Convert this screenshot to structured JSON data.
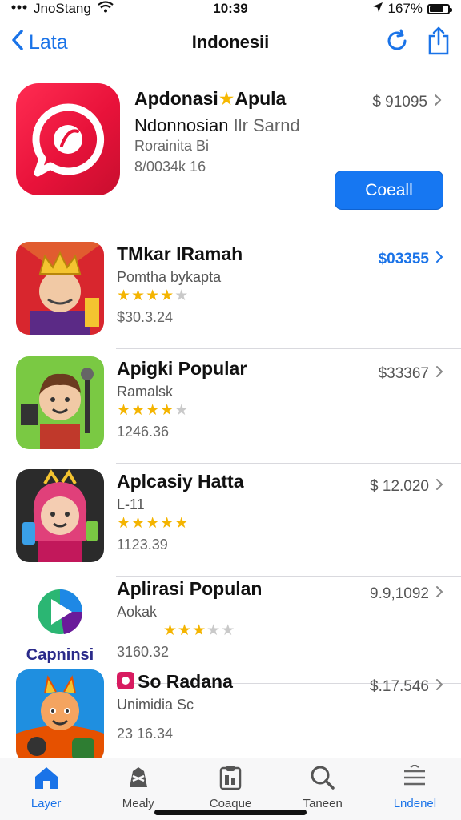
{
  "status_bar": {
    "carrier": "JnoStang",
    "time": "10:39",
    "battery_percent": "167%"
  },
  "nav": {
    "back_label": "Lata",
    "title": "Indonesii"
  },
  "featured": {
    "title": "Apdonasi",
    "title_star": "★",
    "title_suffix": "Apula",
    "subtitle": "Ndonnosian",
    "subtitle_muted": "Ilr Sarnd",
    "meta1": "Rorainita Bi",
    "meta2": "8/0034k 16",
    "price": "$ 91095",
    "button_label": "Coeall"
  },
  "apps": [
    {
      "title": "TMkar IRamah",
      "subtitle": "Pomtha bykapta",
      "rating": 3.5,
      "meta": "$30.3.24",
      "price": "$03355",
      "price_highlight": true
    },
    {
      "title": "Apigki Popular",
      "subtitle": "Ramalsk",
      "rating": 3.5,
      "meta": "1246.36",
      "price": "$33367",
      "price_highlight": false
    },
    {
      "title": "Aplcasiy Hatta",
      "subtitle": "L-11",
      "rating": 4.5,
      "meta": "1123.39",
      "price": "$ 12.020",
      "price_highlight": false
    },
    {
      "title": "Aplirasi Populan",
      "subtitle": "Aokak",
      "rating": 2.5,
      "meta": "3160.32",
      "price": "9.9,1092",
      "price_highlight": false,
      "icon_caption": "Capninsi"
    },
    {
      "title": "So Radana",
      "subtitle": "Unimidia Sc",
      "rating": null,
      "meta": "23 16.34",
      "price": "$.17.546",
      "price_highlight": false
    }
  ],
  "tabs": [
    {
      "label": "Layer",
      "icon": "home-icon",
      "active": true
    },
    {
      "label": "Mealy",
      "icon": "games-icon",
      "active": false
    },
    {
      "label": "Coaque",
      "icon": "apps-icon",
      "active": false
    },
    {
      "label": "Taneen",
      "icon": "search-icon",
      "active": false
    },
    {
      "label": "Lndenel",
      "icon": "menu-icon",
      "active": true
    }
  ],
  "colors": {
    "accent": "#1a73e8",
    "button": "#1677f2",
    "featured_icon": "#e8123a",
    "star": "#f4b400"
  }
}
